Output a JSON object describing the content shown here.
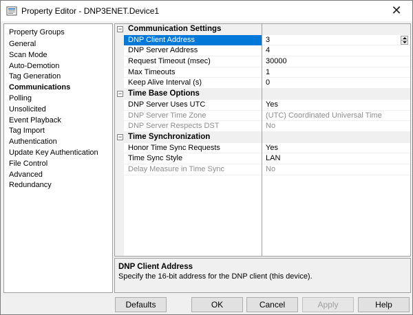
{
  "window": {
    "title": "Property Editor - DNP3ENET.Device1",
    "close_glyph": "✕"
  },
  "nav": {
    "heading": "Property Groups",
    "items": [
      {
        "label": "General"
      },
      {
        "label": "Scan Mode"
      },
      {
        "label": "Auto-Demotion"
      },
      {
        "label": "Tag Generation"
      },
      {
        "label": "Communications",
        "selected": true
      },
      {
        "label": "Polling"
      },
      {
        "label": "Unsolicited"
      },
      {
        "label": "Event Playback"
      },
      {
        "label": "Tag Import"
      },
      {
        "label": "Authentication"
      },
      {
        "label": "Update Key Authentication"
      },
      {
        "label": "File Control"
      },
      {
        "label": "Advanced"
      },
      {
        "label": "Redundancy"
      }
    ]
  },
  "grid": {
    "sections": [
      {
        "title": "Communication Settings",
        "toggle": "⊟",
        "rows": [
          {
            "name": "DNP Client Address",
            "value": "3",
            "selected": true
          },
          {
            "name": "DNP Server Address",
            "value": "4"
          },
          {
            "name": "Request Timeout (msec)",
            "value": "30000"
          },
          {
            "name": "Max Timeouts",
            "value": "1"
          },
          {
            "name": "Keep Alive Interval (s)",
            "value": "0"
          }
        ]
      },
      {
        "title": "Time Base Options",
        "toggle": "⊟",
        "rows": [
          {
            "name": "DNP Server Uses UTC",
            "value": "Yes"
          },
          {
            "name": "DNP Server Time Zone",
            "value": "(UTC) Coordinated Universal Time",
            "disabled": true
          },
          {
            "name": "DNP Server Respects DST",
            "value": "No",
            "disabled": true
          }
        ]
      },
      {
        "title": "Time Synchronization",
        "toggle": "⊟",
        "rows": [
          {
            "name": "Honor Time Sync Requests",
            "value": "Yes"
          },
          {
            "name": "Time Sync Style",
            "value": "LAN"
          },
          {
            "name": "Delay Measure in Time Sync",
            "value": "No",
            "disabled": true
          }
        ]
      }
    ]
  },
  "description": {
    "title": "DNP Client Address",
    "text": "Specify the 16-bit address for the DNP client (this device)."
  },
  "buttons": {
    "defaults": "Defaults",
    "ok": "OK",
    "cancel": "Cancel",
    "apply": "Apply",
    "help": "Help"
  },
  "colors": {
    "selection": "#0078d7",
    "disabled_text": "#8d8d8d"
  }
}
